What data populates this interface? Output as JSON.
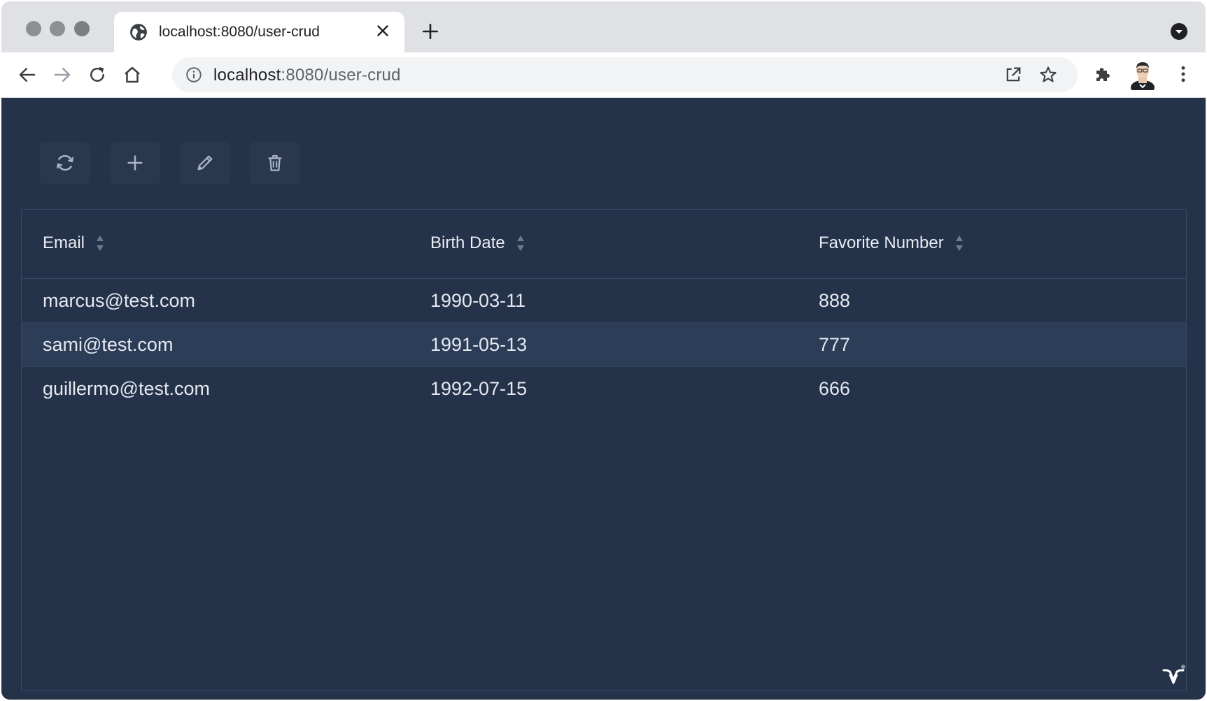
{
  "browser": {
    "tab": {
      "title": "localhost:8080/user-crud"
    },
    "address": {
      "host": "localhost",
      "path": ":8080/user-crud"
    },
    "icons": {
      "tab": [
        "globe-icon",
        "close-icon",
        "plus-icon",
        "chevron-down-icon"
      ],
      "nav": [
        "back-arrow-icon",
        "forward-arrow-icon",
        "reload-icon",
        "home-icon"
      ],
      "omnibox": [
        "info-icon",
        "open-external-icon",
        "star-icon"
      ],
      "toolbar": [
        "puzzle-icon",
        "avatar-icon",
        "kebab-menu-icon"
      ]
    }
  },
  "toolbar": {
    "buttons": [
      {
        "name": "refresh",
        "icon": "refresh-icon"
      },
      {
        "name": "add",
        "icon": "plus-icon"
      },
      {
        "name": "edit",
        "icon": "pencil-icon"
      },
      {
        "name": "delete",
        "icon": "trash-icon"
      }
    ]
  },
  "grid": {
    "columns": [
      "Email",
      "Birth Date",
      "Favorite Number"
    ],
    "rows": [
      {
        "email": "marcus@test.com",
        "birth_date": "1990-03-11",
        "favorite_number": "888",
        "selected": false
      },
      {
        "email": "sami@test.com",
        "birth_date": "1991-05-13",
        "favorite_number": "777",
        "selected": true
      },
      {
        "email": "guillermo@test.com",
        "birth_date": "1992-07-15",
        "favorite_number": "666",
        "selected": false
      }
    ]
  },
  "colors": {
    "app_background": "#24324a",
    "selected_row": "#2c3d58",
    "browser_chrome": "#dfe1e5"
  }
}
